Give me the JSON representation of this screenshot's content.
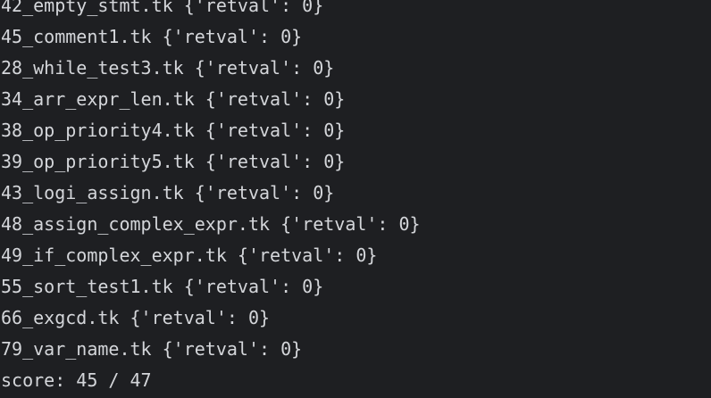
{
  "terminal": {
    "lines": [
      "42_empty_stmt.tk {'retval': 0}",
      "45_comment1.tk {'retval': 0}",
      "28_while_test3.tk {'retval': 0}",
      "34_arr_expr_len.tk {'retval': 0}",
      "38_op_priority4.tk {'retval': 0}",
      "39_op_priority5.tk {'retval': 0}",
      "43_logi_assign.tk {'retval': 0}",
      "48_assign_complex_expr.tk {'retval': 0}",
      "49_if_complex_expr.tk {'retval': 0}",
      "55_sort_test1.tk {'retval': 0}",
      "66_exgcd.tk {'retval': 0}",
      "79_var_name.tk {'retval': 0}",
      "score: 45 / 47"
    ]
  },
  "colors": {
    "background": "#1e1f22",
    "text": "#d4d6da"
  }
}
